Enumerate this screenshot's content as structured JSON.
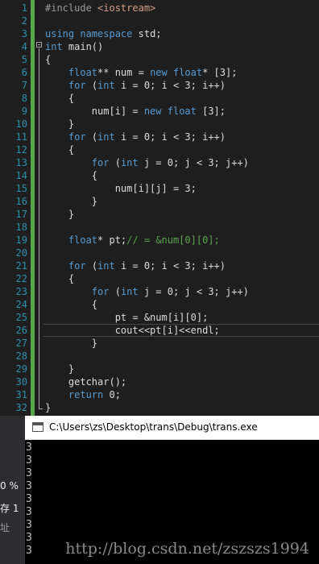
{
  "editor": {
    "line_numbers": [
      "1",
      "2",
      "3",
      "4",
      "5",
      "6",
      "7",
      "8",
      "9",
      "10",
      "11",
      "12",
      "13",
      "14",
      "15",
      "16",
      "17",
      "18",
      "19",
      "20",
      "21",
      "22",
      "23",
      "24",
      "25",
      "26",
      "27",
      "28",
      "29",
      "30",
      "31",
      "32"
    ],
    "lines": [
      [
        {
          "t": "#include ",
          "c": "pp"
        },
        {
          "t": "<iostream>",
          "c": "inc"
        }
      ],
      [],
      [
        {
          "t": "using",
          "c": "kw"
        },
        {
          "t": " "
        },
        {
          "t": "namespace",
          "c": "kw"
        },
        {
          "t": " std;"
        }
      ],
      [
        {
          "t": "int",
          "c": "kw"
        },
        {
          "t": " main()"
        }
      ],
      [
        {
          "t": "{"
        }
      ],
      [
        {
          "t": "    "
        },
        {
          "t": "float",
          "c": "kw"
        },
        {
          "t": "** num = "
        },
        {
          "t": "new",
          "c": "kw"
        },
        {
          "t": " "
        },
        {
          "t": "float",
          "c": "kw"
        },
        {
          "t": "* [3];"
        }
      ],
      [
        {
          "t": "    "
        },
        {
          "t": "for",
          "c": "kw"
        },
        {
          "t": " ("
        },
        {
          "t": "int",
          "c": "kw"
        },
        {
          "t": " i = 0; i < 3; i++)"
        }
      ],
      [
        {
          "t": "    {"
        }
      ],
      [
        {
          "t": "        num[i] = "
        },
        {
          "t": "new",
          "c": "kw"
        },
        {
          "t": " "
        },
        {
          "t": "float",
          "c": "kw"
        },
        {
          "t": " [3];"
        }
      ],
      [
        {
          "t": "    }"
        }
      ],
      [
        {
          "t": "    "
        },
        {
          "t": "for",
          "c": "kw"
        },
        {
          "t": " ("
        },
        {
          "t": "int",
          "c": "kw"
        },
        {
          "t": " i = 0; i < 3; i++)"
        }
      ],
      [
        {
          "t": "    {"
        }
      ],
      [
        {
          "t": "        "
        },
        {
          "t": "for",
          "c": "kw"
        },
        {
          "t": " ("
        },
        {
          "t": "int",
          "c": "kw"
        },
        {
          "t": " j = 0; j < 3; j++)"
        }
      ],
      [
        {
          "t": "        {"
        }
      ],
      [
        {
          "t": "            num[i][j] = 3;"
        }
      ],
      [
        {
          "t": "        }"
        }
      ],
      [
        {
          "t": "    }"
        }
      ],
      [],
      [
        {
          "t": "    "
        },
        {
          "t": "float",
          "c": "kw"
        },
        {
          "t": "* pt;"
        },
        {
          "t": "// = &num[0][0];",
          "c": "cm"
        }
      ],
      [],
      [
        {
          "t": "    "
        },
        {
          "t": "for",
          "c": "kw"
        },
        {
          "t": " ("
        },
        {
          "t": "int",
          "c": "kw"
        },
        {
          "t": " i = 0; i < 3; i++)"
        }
      ],
      [
        {
          "t": "    {"
        }
      ],
      [
        {
          "t": "        "
        },
        {
          "t": "for",
          "c": "kw"
        },
        {
          "t": " ("
        },
        {
          "t": "int",
          "c": "kw"
        },
        {
          "t": " j = 0; j < 3; j++)"
        }
      ],
      [
        {
          "t": "        {"
        }
      ],
      [
        {
          "t": "            pt = &num[i][0];"
        }
      ],
      [
        {
          "t": "            cout<<pt[i]<<endl;"
        }
      ],
      [
        {
          "t": "        }"
        }
      ],
      [],
      [
        {
          "t": "    }"
        }
      ],
      [
        {
          "t": "    getchar();"
        }
      ],
      [
        {
          "t": "    "
        },
        {
          "t": "return",
          "c": "kw"
        },
        {
          "t": " 0;"
        }
      ],
      [
        {
          "t": "}"
        }
      ]
    ]
  },
  "left_panel": {
    "percent_fragment": "0 %",
    "save_fragment": "存 1",
    "address_fragment": "址"
  },
  "console": {
    "title": "C:\\Users\\zs\\Desktop\\trans\\Debug\\trans.exe",
    "output_lines": [
      "3",
      "3",
      "3",
      "3",
      "3",
      "3",
      "3",
      "3",
      "3"
    ],
    "watermark": "http://blog.csdn.net/zszszs1994"
  },
  "colors": {
    "editor_bg": "#1e1e1e",
    "line_number": "#2b91af",
    "keyword": "#569cd6",
    "preprocessor": "#9b9b9b",
    "include_string": "#d69d85",
    "comment": "#57a64a",
    "code_text": "#dcdcdc",
    "console_bg": "#000000",
    "console_text": "#c0c0c0"
  }
}
